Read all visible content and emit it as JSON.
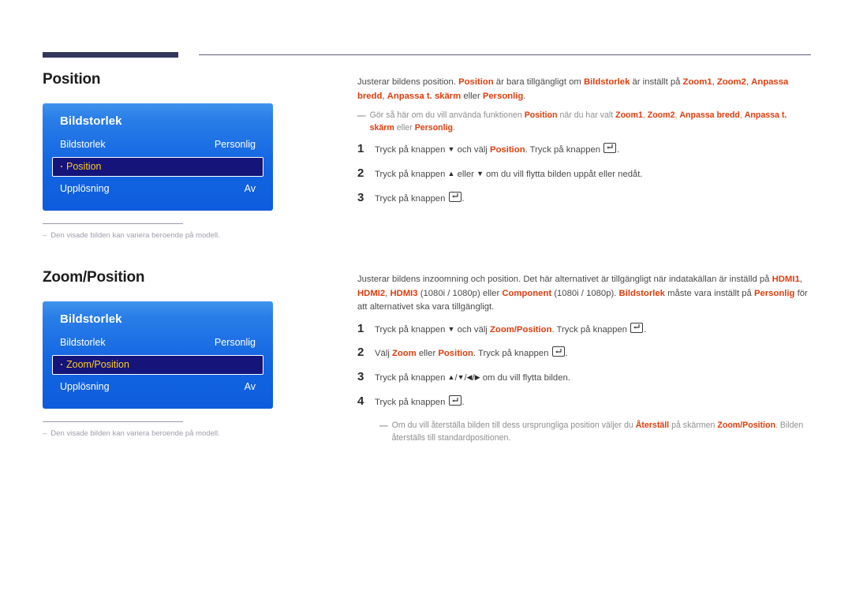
{
  "page": {
    "language": "sv",
    "accent_color": "#e03c0c",
    "osd_highlight_color": "#ffcc22",
    "osd_blue_top": "#3f93ec",
    "osd_blue_bottom": "#0d5cdd",
    "rule_color": "#33365c"
  },
  "sections": [
    {
      "title": "Position",
      "osd": {
        "title": "Bildstorlek",
        "rows": [
          {
            "label": "Bildstorlek",
            "value": "Personlig",
            "selected": false
          },
          {
            "label": "Position",
            "value": "",
            "selected": true
          },
          {
            "label": "Upplösning",
            "value": "Av",
            "selected": false
          }
        ]
      },
      "note": {
        "dash": "–",
        "text": "Den visade bilden kan variera beroende på modell."
      },
      "intro": [
        {
          "t": "Justerar bildens position. ",
          "a": false
        },
        {
          "t": "Position",
          "a": true
        },
        {
          "t": " är bara tillgängligt om ",
          "a": false
        },
        {
          "t": "Bildstorlek",
          "a": true
        },
        {
          "t": " är inställt på ",
          "a": false
        },
        {
          "t": "Zoom1",
          "a": true
        },
        {
          "t": ", ",
          "a": false
        },
        {
          "t": "Zoom2",
          "a": true
        },
        {
          "t": ", ",
          "a": false
        },
        {
          "t": "Anpassa bredd",
          "a": true
        },
        {
          "t": ", ",
          "a": false
        },
        {
          "t": "Anpassa t. skärm",
          "a": true
        },
        {
          "t": " eller ",
          "a": false
        },
        {
          "t": "Personlig",
          "a": true
        },
        {
          "t": ".",
          "a": false
        }
      ],
      "subnote": [
        {
          "t": "Gör så här om du vill använda funktionen ",
          "a": false
        },
        {
          "t": "Position",
          "a": true
        },
        {
          "t": " när du har valt ",
          "a": false
        },
        {
          "t": "Zoom1",
          "a": true
        },
        {
          "t": ", ",
          "a": false
        },
        {
          "t": "Zoom2",
          "a": true
        },
        {
          "t": ", ",
          "a": false
        },
        {
          "t": "Anpassa bredd",
          "a": true
        },
        {
          "t": ", ",
          "a": false
        },
        {
          "t": "Anpassa t. skärm",
          "a": true
        },
        {
          "t": " eller ",
          "a": false
        },
        {
          "t": "Personlig",
          "a": true
        },
        {
          "t": ".",
          "a": false
        }
      ],
      "steps": [
        {
          "num": "1",
          "parts": [
            {
              "t": "Tryck på knappen ",
              "a": false
            },
            {
              "g": "down"
            },
            {
              "t": " och välj ",
              "a": false
            },
            {
              "t": "Position",
              "a": true
            },
            {
              "t": ". Tryck på knappen ",
              "a": false
            },
            {
              "g": "enter"
            },
            {
              "t": ".",
              "a": false
            }
          ]
        },
        {
          "num": "2",
          "parts": [
            {
              "t": "Tryck på knappen ",
              "a": false
            },
            {
              "g": "up"
            },
            {
              "t": " eller ",
              "a": false
            },
            {
              "g": "down"
            },
            {
              "t": " om du vill flytta bilden uppåt eller nedåt.",
              "a": false
            }
          ]
        },
        {
          "num": "3",
          "parts": [
            {
              "t": "Tryck på knappen ",
              "a": false
            },
            {
              "g": "enter"
            },
            {
              "t": ".",
              "a": false
            }
          ]
        }
      ],
      "endnote": []
    },
    {
      "title": "Zoom/Position",
      "osd": {
        "title": "Bildstorlek",
        "rows": [
          {
            "label": "Bildstorlek",
            "value": "Personlig",
            "selected": false
          },
          {
            "label": "Zoom/Position",
            "value": "",
            "selected": true
          },
          {
            "label": "Upplösning",
            "value": "Av",
            "selected": false
          }
        ]
      },
      "note": {
        "dash": "–",
        "text": "Den visade bilden kan variera beroende på modell."
      },
      "intro": [
        {
          "t": "Justerar bildens inzoomning och position. Det här alternativet är tillgängligt när indatakällan är inställd på ",
          "a": false
        },
        {
          "t": "HDMI1",
          "a": true
        },
        {
          "t": ", ",
          "a": false
        },
        {
          "t": "HDMI2",
          "a": true
        },
        {
          "t": ", ",
          "a": false
        },
        {
          "t": "HDMI3",
          "a": true
        },
        {
          "t": " (1080i / 1080p) eller ",
          "a": false
        },
        {
          "t": "Component",
          "a": true
        },
        {
          "t": " (1080i / 1080p). ",
          "a": false
        },
        {
          "t": "Bildstorlek",
          "a": true
        },
        {
          "t": " måste vara inställt på ",
          "a": false
        },
        {
          "t": "Personlig",
          "a": true
        },
        {
          "t": " för att alternativet ska vara tillgängligt.",
          "a": false
        }
      ],
      "subnote": [],
      "steps": [
        {
          "num": "1",
          "parts": [
            {
              "t": "Tryck på knappen ",
              "a": false
            },
            {
              "g": "down"
            },
            {
              "t": " och välj ",
              "a": false
            },
            {
              "t": "Zoom/Position",
              "a": true
            },
            {
              "t": ". Tryck på knappen ",
              "a": false
            },
            {
              "g": "enter"
            },
            {
              "t": ".",
              "a": false
            }
          ]
        },
        {
          "num": "2",
          "parts": [
            {
              "t": "Välj ",
              "a": false
            },
            {
              "t": "Zoom",
              "a": true
            },
            {
              "t": " eller ",
              "a": false
            },
            {
              "t": "Position",
              "a": true
            },
            {
              "t": ". Tryck på knappen ",
              "a": false
            },
            {
              "g": "enter"
            },
            {
              "t": ".",
              "a": false
            }
          ]
        },
        {
          "num": "3",
          "parts": [
            {
              "t": "Tryck på knappen ",
              "a": false
            },
            {
              "g": "up"
            },
            {
              "t": "/",
              "a": false
            },
            {
              "g": "down"
            },
            {
              "t": "/",
              "a": false
            },
            {
              "g": "left"
            },
            {
              "t": "/",
              "a": false
            },
            {
              "g": "right"
            },
            {
              "t": " om du vill flytta bilden.",
              "a": false
            }
          ]
        },
        {
          "num": "4",
          "parts": [
            {
              "t": "Tryck på knappen ",
              "a": false
            },
            {
              "g": "enter"
            },
            {
              "t": ".",
              "a": false
            }
          ]
        }
      ],
      "endnote": [
        {
          "t": "Om du vill återställa bilden till dess ursprungliga position väljer du ",
          "a": false
        },
        {
          "t": "Återställ",
          "a": true
        },
        {
          "t": " på skärmen ",
          "a": false
        },
        {
          "t": "Zoom/Position",
          "a": true
        },
        {
          "t": ". Bilden återställs till standardpositionen.",
          "a": false
        }
      ]
    }
  ]
}
